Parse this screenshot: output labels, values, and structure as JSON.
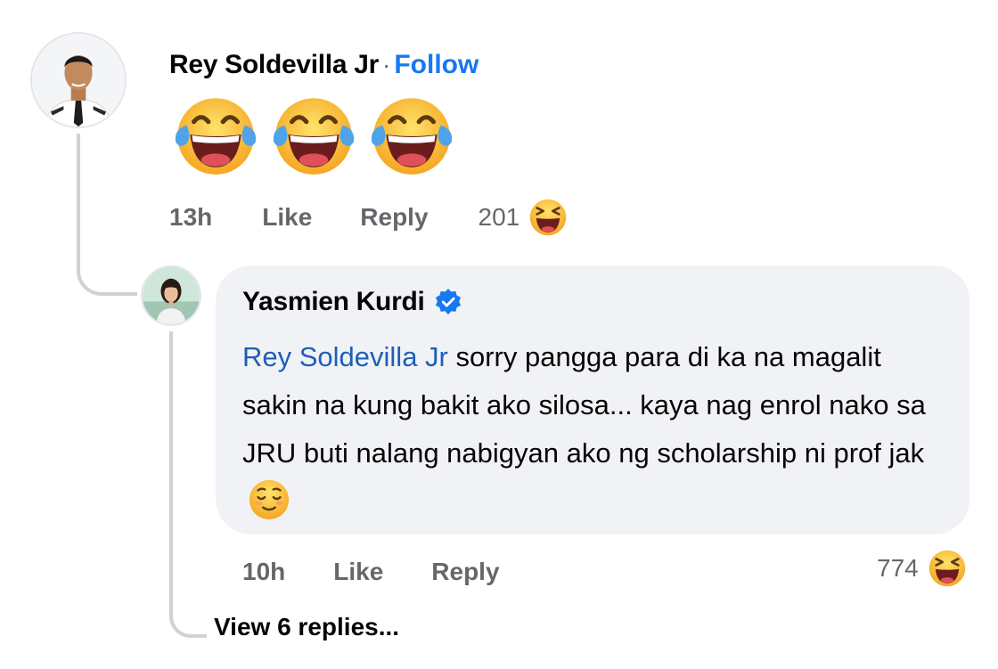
{
  "colors": {
    "link_blue": "#1877f2",
    "mention_blue": "#1d5fb8",
    "bubble_bg": "#f0f2f5",
    "secondary_text": "#65676b",
    "thread_line": "#cfd2d6",
    "verified_badge": "#1877f2"
  },
  "comment": {
    "author": "Rey Soldevilla Jr",
    "separator": "·",
    "follow_label": "Follow",
    "avatar_icon": "profile-photo-man-uniform",
    "content_emojis": [
      "face-with-tears-of-joy",
      "face-with-tears-of-joy",
      "face-with-tears-of-joy"
    ],
    "time": "13h",
    "like_label": "Like",
    "reply_label": "Reply",
    "reaction_count": "201",
    "reaction_icon": "haha-reaction-icon"
  },
  "reply": {
    "author": "Yasmien Kurdi",
    "verified_icon": "verified-badge-icon",
    "avatar_icon": "profile-photo-woman",
    "mention": "Rey Soldevilla Jr",
    "text": " sorry pangga para di ka na magalit sakin na kung bakit ako silosa... kaya nag enrol nako sa JRU buti nalang nabigyan ako ng scholarship ni prof jak",
    "trailing_emoji": "relieved-face",
    "time": "10h",
    "like_label": "Like",
    "reply_label": "Reply",
    "reaction_count": "774",
    "reaction_icon": "haha-reaction-icon"
  },
  "view_replies_label": "View 6 replies..."
}
